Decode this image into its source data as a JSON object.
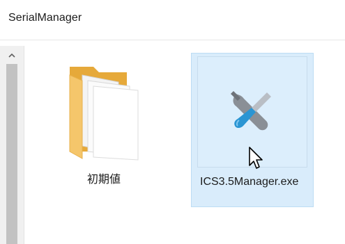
{
  "window": {
    "title": "SerialManager"
  },
  "files": [
    {
      "name": "初期値",
      "type": "folder",
      "icon": "folder-icon"
    },
    {
      "name": "ICS3.5Manager.exe",
      "type": "application",
      "icon": "tools-icon",
      "selected": true
    }
  ],
  "colors": {
    "selection_bg": "#d9ecfb",
    "selection_border": "#bcdcf4",
    "folder": "#f5c66b",
    "scrollbar": "#f0f0f0"
  }
}
